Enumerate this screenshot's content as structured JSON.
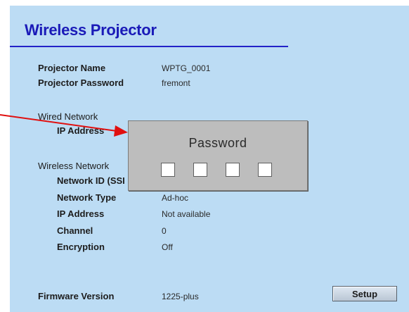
{
  "header": {
    "title": "Wireless Projector"
  },
  "projector": {
    "name_label": "Projector Name",
    "name_value": "WPTG_0001",
    "password_label": "Projector Password",
    "password_value": "fremont"
  },
  "wired": {
    "heading": "Wired Network",
    "ip_label": "IP Address"
  },
  "wireless": {
    "heading": "Wireless Network",
    "ssid_label": "Network ID (SSI",
    "type_label": "Network Type",
    "type_value": "Ad-hoc",
    "ip_label": "IP Address",
    "ip_value": "Not available",
    "channel_label": "Channel",
    "channel_value": "0",
    "encryption_label": "Encryption",
    "encryption_value": "Off"
  },
  "firmware": {
    "label": "Firmware Version",
    "value": "1225-plus"
  },
  "buttons": {
    "setup_label": "Setup"
  },
  "password_dialog": {
    "title": "Password",
    "digit_count": 4
  },
  "colors": {
    "panel_bg": "#bcdcf4",
    "title": "#1a1ab8",
    "dialog_bg": "#bdbdbd",
    "arrow": "#e01010"
  }
}
